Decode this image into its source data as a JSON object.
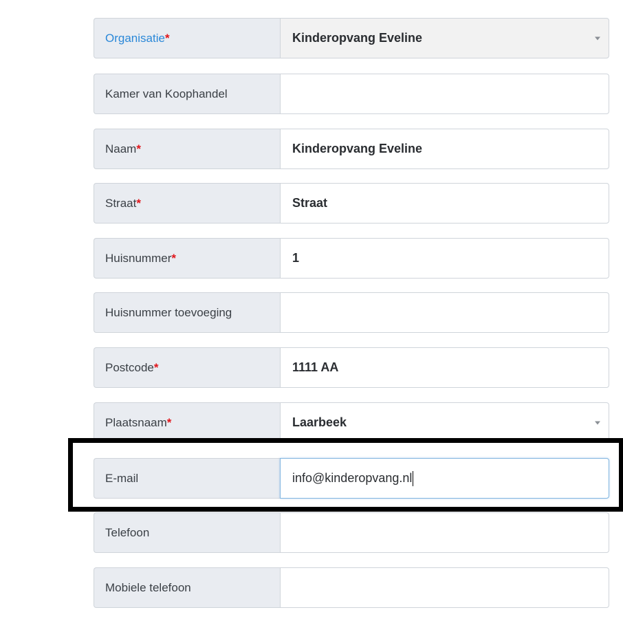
{
  "form": {
    "organisatie": {
      "label": "Organisatie",
      "required": "*",
      "value": "Kinderopvang Eveline"
    },
    "kvk": {
      "label": "Kamer van Koophandel",
      "value": ""
    },
    "naam": {
      "label": "Naam",
      "required": "*",
      "value": "Kinderopvang Eveline"
    },
    "straat": {
      "label": "Straat",
      "required": "*",
      "value": "Straat"
    },
    "huisnummer": {
      "label": "Huisnummer",
      "required": "*",
      "value": "1"
    },
    "toevoeging": {
      "label": "Huisnummer toevoeging",
      "value": ""
    },
    "postcode": {
      "label": "Postcode",
      "required": "*",
      "value": "1111 AA"
    },
    "plaatsnaam": {
      "label": "Plaatsnaam",
      "required": "*",
      "value": "Laarbeek"
    },
    "email": {
      "label": "E-mail",
      "value": "info@kinderopvang.nl"
    },
    "telefoon": {
      "label": "Telefoon",
      "value": ""
    },
    "mobiel": {
      "label": "Mobiele telefoon",
      "value": ""
    }
  },
  "colors": {
    "required_marker": "#e0151b",
    "label_background": "#e9ecf1",
    "highlight_border": "#000000",
    "organisatie_label": "#2b88d8"
  }
}
